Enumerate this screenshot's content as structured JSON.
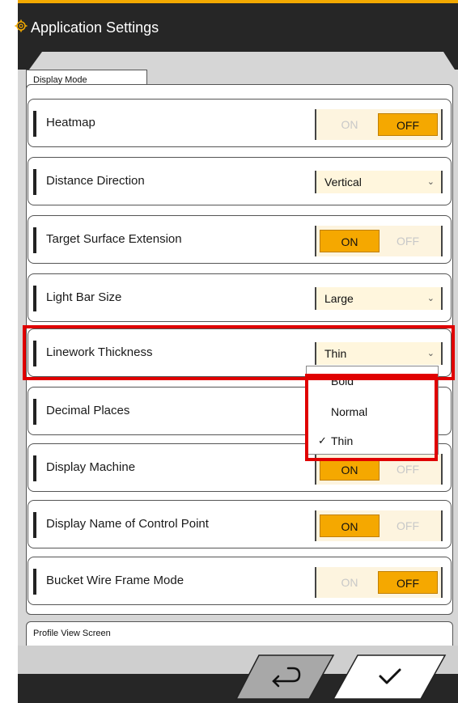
{
  "header": {
    "title": "Application Settings"
  },
  "sections": [
    {
      "title": "Display Mode"
    },
    {
      "title": "Profile View Screen"
    }
  ],
  "rows": [
    {
      "label": "Heatmap",
      "type": "toggle",
      "on_label": "ON",
      "off_label": "OFF",
      "value": "OFF"
    },
    {
      "label": "Distance Direction",
      "type": "select",
      "value": "Vertical"
    },
    {
      "label": "Target Surface Extension",
      "type": "toggle",
      "on_label": "ON",
      "off_label": "OFF",
      "value": "ON"
    },
    {
      "label": "Light Bar Size",
      "type": "select",
      "value": "Large"
    },
    {
      "label": "Linework Thickness",
      "type": "select",
      "value": "Thin"
    },
    {
      "label": "Decimal Places",
      "type": "select",
      "value": ""
    },
    {
      "label": "Display Machine",
      "type": "toggle",
      "on_label": "ON",
      "off_label": "OFF",
      "value": "ON"
    },
    {
      "label": "Display Name of Control Point",
      "type": "toggle",
      "on_label": "ON",
      "off_label": "OFF",
      "value": "ON"
    },
    {
      "label": "Bucket Wire Frame Mode",
      "type": "toggle",
      "on_label": "ON",
      "off_label": "OFF",
      "value": "OFF"
    }
  ],
  "dropdown": {
    "options": [
      "Bold",
      "Normal",
      "Thin"
    ],
    "selected": "Thin"
  },
  "colors": {
    "accent": "#f5a800",
    "highlight": "#e00000",
    "header": "#262626"
  },
  "icons": {
    "header": "gear-icon",
    "back": "return-arrow-icon",
    "confirm": "checkmark-icon"
  }
}
